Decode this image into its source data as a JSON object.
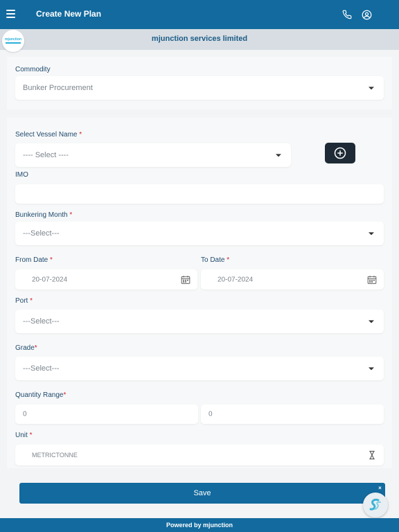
{
  "header": {
    "title": "Create New Plan"
  },
  "brand": {
    "company": "mjunction services limited",
    "logo_text": "mjunction"
  },
  "commodity": {
    "label": "Commodity",
    "value": "Bunker Procurement"
  },
  "vessel": {
    "label": "Select Vessel Name",
    "required": "*",
    "value": "---- Select ----"
  },
  "imo": {
    "label": "IMO",
    "value": ""
  },
  "bunkering_month": {
    "label": "Bunkering Month",
    "required": "*",
    "value": "---Select---"
  },
  "from_date": {
    "label": "From Date",
    "required": "*",
    "value": "20-07-2024"
  },
  "to_date": {
    "label": "To Date",
    "required": "*",
    "value": "20-07-2024"
  },
  "port": {
    "label": "Port",
    "required": "*",
    "value": "---Select---"
  },
  "grade": {
    "label": "Grade",
    "required": "*",
    "value": "---Select---"
  },
  "quantity_range": {
    "label": "Quantity Range",
    "required": "*",
    "min": "0",
    "max": "0"
  },
  "unit": {
    "label": "Unit",
    "required": "*",
    "value": "METRICTONNE"
  },
  "save_label": "Save",
  "footer": {
    "text": "Powered by mjunction"
  },
  "chat": {
    "close": "×"
  },
  "colors": {
    "primary": "#126a9e",
    "required": "#d21f2a",
    "add_button": "#1e2b36"
  }
}
